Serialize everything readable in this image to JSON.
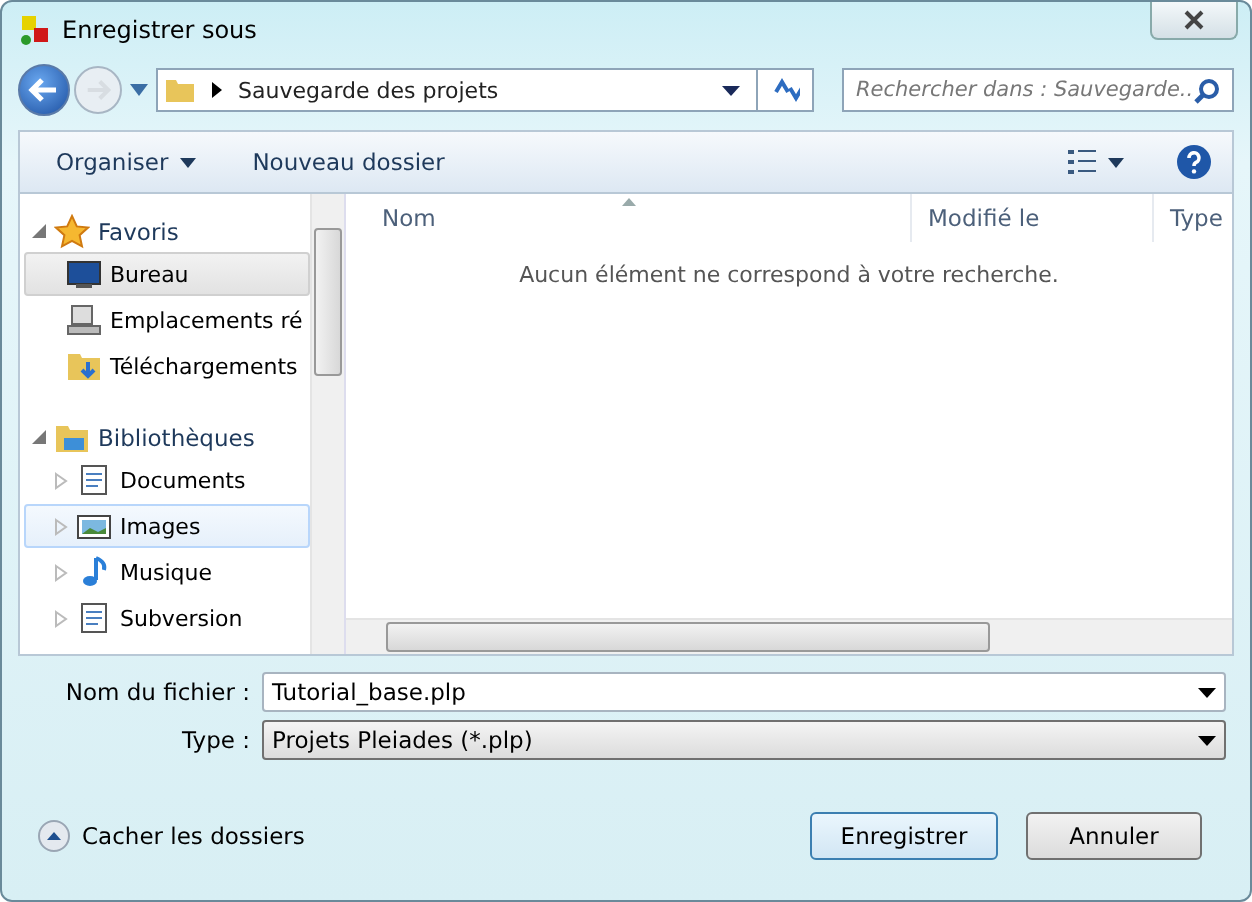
{
  "window": {
    "title": "Enregistrer sous"
  },
  "address_bar": {
    "path": "Sauvegarde des projets"
  },
  "search": {
    "placeholder": "Rechercher dans : Sauvegarde..."
  },
  "toolbar": {
    "buttons": [
      "Organiser",
      "Nouveau dossier"
    ]
  },
  "sidebar": {
    "groups": [
      {
        "label": "Favoris",
        "expanded": true,
        "children": [
          {
            "label": "Bureau",
            "selected": true,
            "hovered": false
          },
          {
            "label": "Emplacements ré",
            "selected": false,
            "hovered": false
          },
          {
            "label": "Téléchargements",
            "selected": false,
            "hovered": false
          }
        ]
      },
      {
        "label": "Bibliothèques",
        "expanded": true,
        "children": [
          {
            "label": "Documents",
            "selected": false,
            "hovered": false
          },
          {
            "label": "Images",
            "selected": false,
            "hovered": true
          },
          {
            "label": "Musique",
            "selected": false,
            "hovered": false
          },
          {
            "label": "Subversion",
            "selected": false,
            "hovered": false
          }
        ]
      }
    ]
  },
  "file_list": {
    "columns": [
      "Nom",
      "Modifié le",
      "Type"
    ],
    "empty_message": "Aucun élément ne correspond à votre recherche."
  },
  "form": {
    "filename_label": "Nom du fichier :",
    "filename": "Tutorial_base.plp",
    "type_label": "Type :",
    "type": "Projets Pleiades (*.plp)"
  },
  "footer": {
    "toggle": "Cacher les dossiers",
    "buttons": [
      {
        "label": "Enregistrer",
        "default": true
      },
      {
        "label": "Annuler",
        "default": false
      }
    ]
  }
}
